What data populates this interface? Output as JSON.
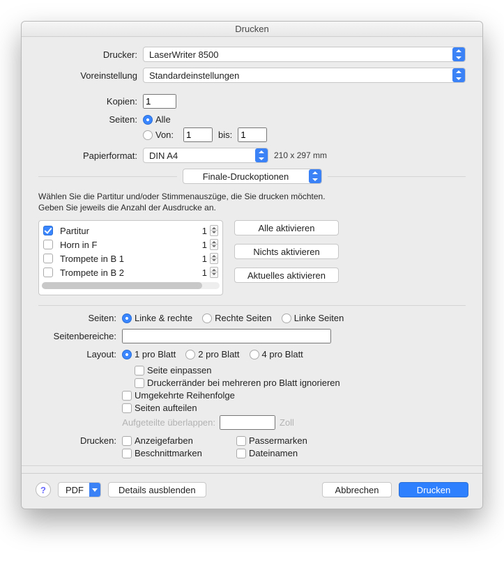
{
  "title": "Drucken",
  "labels": {
    "printer": "Drucker:",
    "preset": "Voreinstellung",
    "copies": "Kopien:",
    "pages": "Seiten:",
    "all": "Alle",
    "from": "Von:",
    "to": "bis:",
    "paperformat": "Papierformat:",
    "paper_dim": "210 x 297 mm",
    "section": "Finale-Druckoptionen",
    "hint1": "Wählen Sie die Partitur und/oder Stimmenauszüge, die Sie drucken möchten.",
    "hint2": "Geben Sie jeweils die Anzahl der Ausdrucke an.",
    "activate_all": "Alle aktivieren",
    "activate_none": "Nichts aktivieren",
    "activate_current": "Aktuelles aktivieren",
    "pages2": "Seiten:",
    "lr": "Linke & rechte",
    "right": "Rechte Seiten",
    "left": "Linke Seiten",
    "ranges": "Seitenbereiche:",
    "layout": "Layout:",
    "l1": "1 pro Blatt",
    "l2": "2 pro Blatt",
    "l4": "4 pro Blatt",
    "fit": "Seite einpassen",
    "ignore_margins": "Druckerränder bei mehreren pro Blatt ignorieren",
    "reverse": "Umgekehrte Reihenfolge",
    "split": "Seiten aufteilen",
    "overlap": "Aufgeteilte überlappen:",
    "overlap_unit": "Zoll",
    "print": "Drucken:",
    "display_colors": "Anzeigefarben",
    "regmarks": "Passermarken",
    "cropmarks": "Beschnittmarken",
    "filenames": "Dateinamen",
    "help": "?",
    "pdf": "PDF",
    "hide_details": "Details ausblenden",
    "cancel": "Abbrechen",
    "do_print": "Drucken"
  },
  "values": {
    "printer": "LaserWriter 8500",
    "preset": "Standardeinstellungen",
    "copies": "1",
    "from": "1",
    "to": "1",
    "paper": "DIN A4",
    "ranges": "",
    "overlap": ""
  },
  "parts": [
    {
      "name": "Partitur",
      "count": "1",
      "checked": true
    },
    {
      "name": "Horn in F",
      "count": "1",
      "checked": false
    },
    {
      "name": "Trompete in B 1",
      "count": "1",
      "checked": false
    },
    {
      "name": "Trompete in B 2",
      "count": "1",
      "checked": false
    }
  ]
}
